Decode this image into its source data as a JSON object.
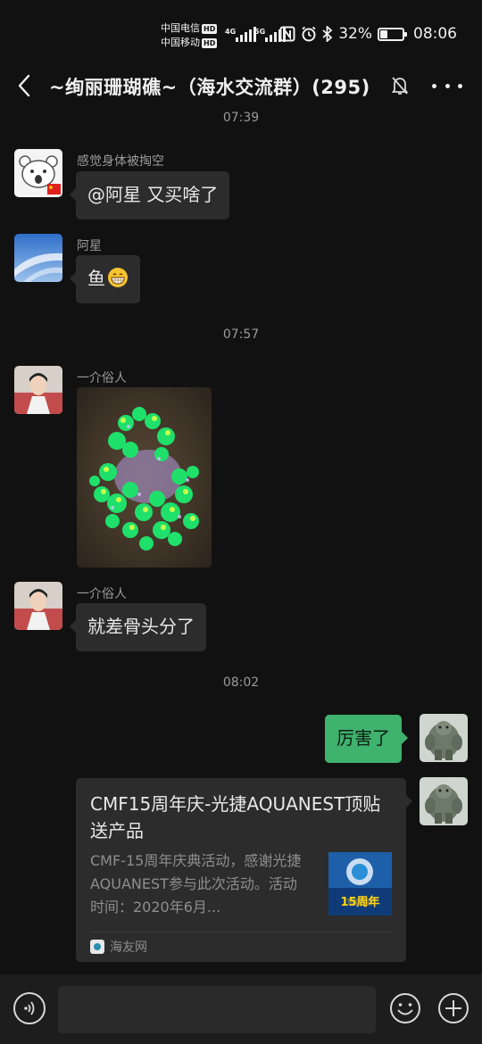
{
  "status_bar": {
    "carrier_1": "中国电信",
    "carrier_2": "中国移动",
    "hd_label": "HD",
    "network_1": "4G",
    "network_2": "5G",
    "icons": [
      "nfc-icon",
      "alarm-icon",
      "bluetooth-icon"
    ],
    "battery_percent": "32%",
    "battery_level": 0.32,
    "time": "08:06"
  },
  "header": {
    "title": "~绚丽珊瑚礁~（海水交流群）(295)",
    "muted": true
  },
  "messages": [
    {
      "type": "time",
      "text": "07:39"
    },
    {
      "type": "text",
      "side": "left",
      "sender": "感觉身体被掏空",
      "text": "@阿星  又买啥了"
    },
    {
      "type": "text",
      "side": "left",
      "sender": "阿星",
      "text": "鱼",
      "emoji": "grin-emoji"
    },
    {
      "type": "time",
      "text": "07:57"
    },
    {
      "type": "image",
      "side": "left",
      "sender": "一介俗人"
    },
    {
      "type": "text",
      "side": "left",
      "sender": "一介俗人",
      "text": "就差骨头分了"
    },
    {
      "type": "time",
      "text": "08:02"
    },
    {
      "type": "text",
      "side": "right",
      "text": "厉害了"
    },
    {
      "type": "link",
      "side": "right",
      "title": "CMF15周年庆-光捷AQUANEST顶贴送产品",
      "description": "CMF-15周年庆典活动，感谢光捷AQUANEST参与此次活动。活动时间：2020年6月...",
      "thumb_text": "15周年",
      "source": "海友网"
    }
  ],
  "input_bar": {
    "placeholder": ""
  },
  "colors": {
    "background": "#111111",
    "bubble_left": "#2c2c2c",
    "bubble_right": "#3fb26e",
    "muted_text": "#9a9a9a"
  }
}
